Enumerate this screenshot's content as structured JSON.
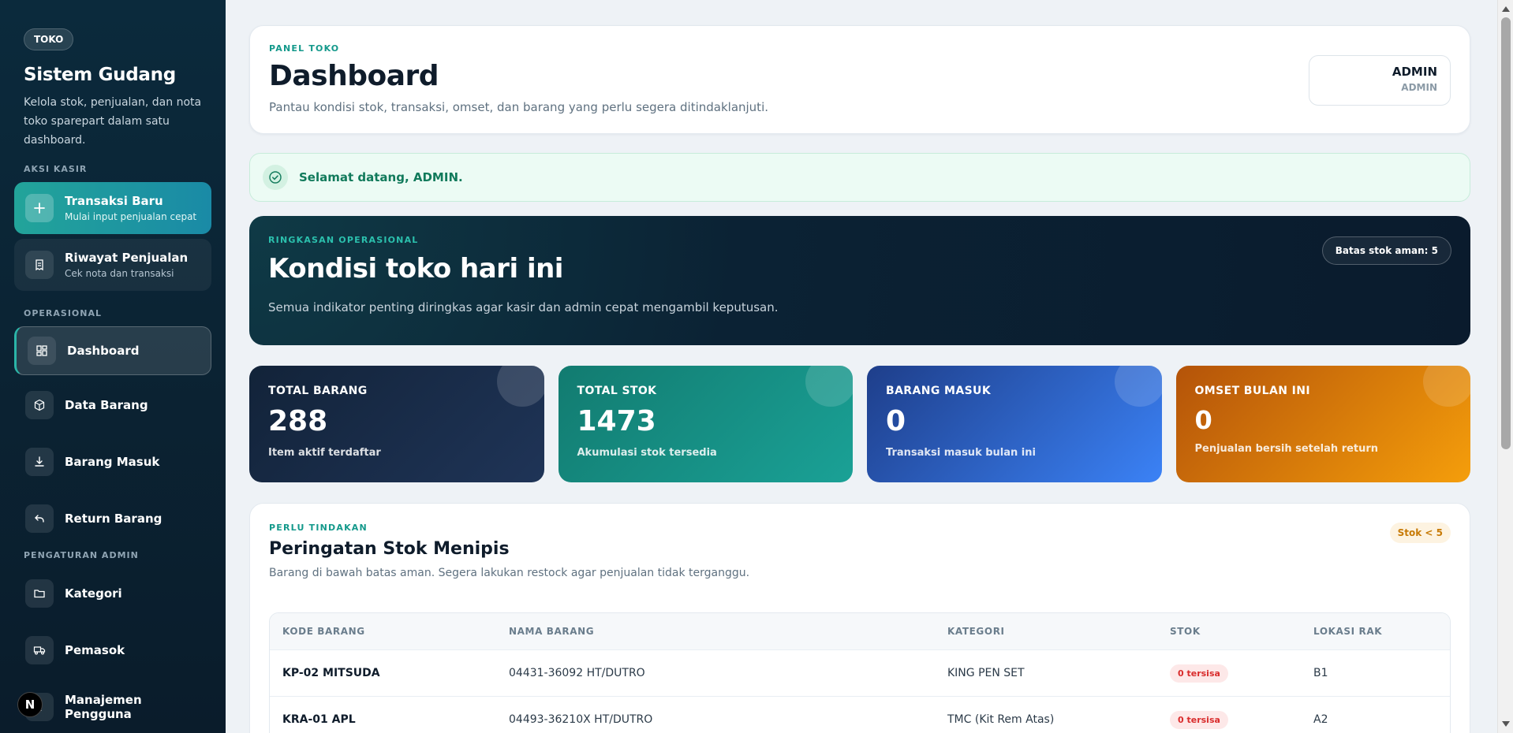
{
  "sidebar": {
    "badge": "TOKO",
    "title": "Sistem Gudang",
    "description": "Kelola stok, penjualan, dan nota toko sparepart dalam satu dashboard.",
    "section_kasir": "AKSI KASIR",
    "new_transaction": {
      "title": "Transaksi Baru",
      "subtitle": "Mulai input penjualan cepat"
    },
    "sales_history": {
      "title": "Riwayat Penjualan",
      "subtitle": "Cek nota dan transaksi"
    },
    "section_ops": "OPERASIONAL",
    "ops_items": [
      "Dashboard",
      "Data Barang",
      "Barang Masuk",
      "Return Barang"
    ],
    "section_admin": "PENGATURAN ADMIN",
    "admin_items": [
      "Kategori",
      "Pemasok",
      "Manajemen Pengguna"
    ]
  },
  "header": {
    "kicker": "PANEL TOKO",
    "title": "Dashboard",
    "subtitle": "Pantau kondisi stok, transaksi, omset, dan barang yang perlu segera ditindaklanjuti.",
    "user_name": "ADMIN",
    "user_role": "ADMIN"
  },
  "alert": {
    "text": "Selamat datang, ADMIN."
  },
  "summary": {
    "kicker": "RINGKASAN OPERASIONAL",
    "title": "Kondisi toko hari ini",
    "subtitle": "Semua indikator penting diringkas agar kasir dan admin cepat mengambil keputusan.",
    "pill": "Batas stok aman: 5"
  },
  "stats": [
    {
      "label": "TOTAL BARANG",
      "value": "288",
      "desc": "Item aktif terdaftar"
    },
    {
      "label": "TOTAL STOK",
      "value": "1473",
      "desc": "Akumulasi stok tersedia"
    },
    {
      "label": "BARANG MASUK",
      "value": "0",
      "desc": "Transaksi masuk bulan ini"
    },
    {
      "label": "OMSET BULAN INI",
      "value": "0",
      "desc": "Penjualan bersih setelah return"
    }
  ],
  "stock": {
    "kicker": "PERLU TINDAKAN",
    "title": "Peringatan Stok Menipis",
    "subtitle": "Barang di bawah batas aman. Segera lakukan restock agar penjualan tidak terganggu.",
    "pill": "Stok < 5",
    "columns": [
      "KODE BARANG",
      "NAMA BARANG",
      "KATEGORI",
      "STOK",
      "LOKASI RAK"
    ],
    "rows": [
      {
        "code": "KP-02 MITSUDA",
        "name": "04431-36092 HT/DUTRO",
        "category": "KING PEN SET",
        "stock": "0 tersisa",
        "rack": "B1"
      },
      {
        "code": "KRA-01 APL",
        "name": "04493-36210X HT/DUTRO",
        "category": "TMC (Kit Rem Atas)",
        "stock": "0 tersisa",
        "rack": "A2"
      }
    ]
  },
  "colors": {
    "accent": "#14998b",
    "sidebar": "#0b2333",
    "danger": "#d92c2c",
    "warning": "#c77a06"
  }
}
